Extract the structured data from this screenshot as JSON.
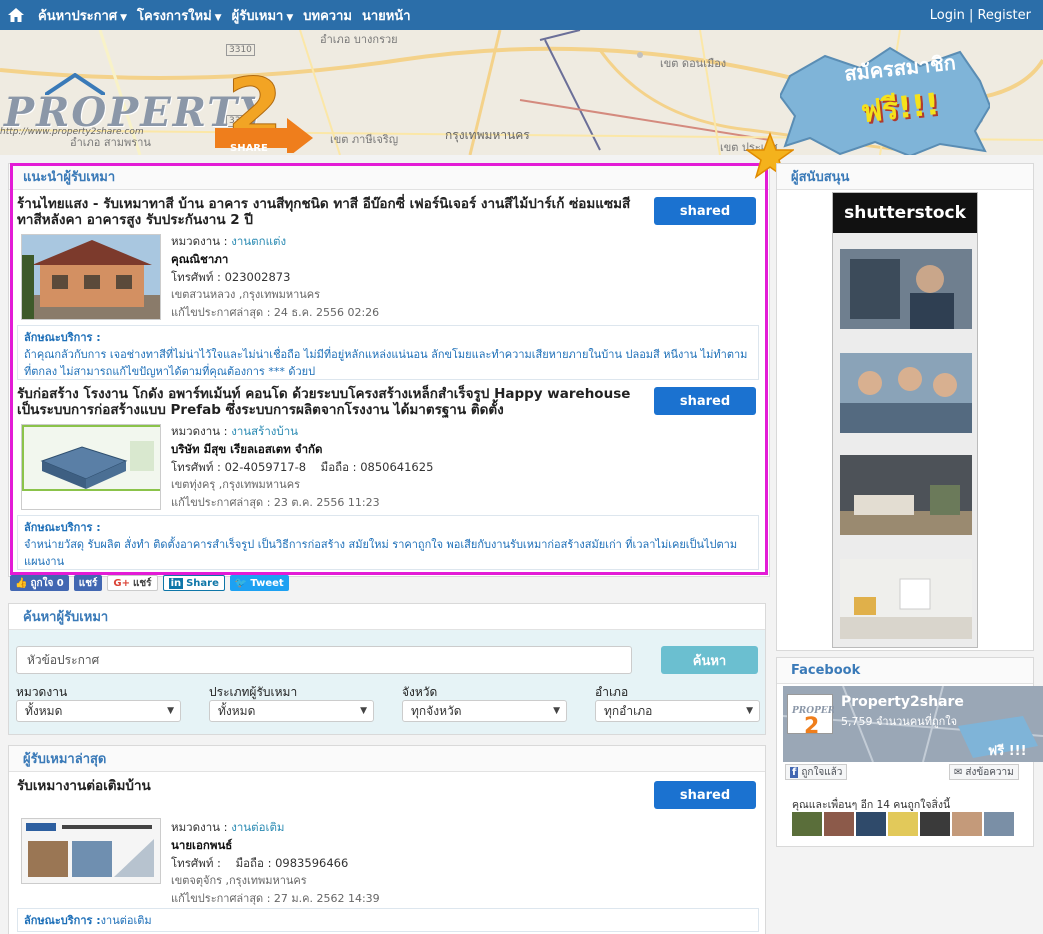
{
  "nav": {
    "items": [
      {
        "label": "ค้นหาประกาศ",
        "dropdown": true
      },
      {
        "label": "โครงการใหม่",
        "dropdown": true
      },
      {
        "label": "ผู้รับเหมา",
        "dropdown": true
      },
      {
        "label": "บทความ",
        "dropdown": false
      },
      {
        "label": "นายหน้า",
        "dropdown": false
      }
    ],
    "auth": "Login | Register"
  },
  "banner": {
    "logo_text": "PROPERTY",
    "logo_url": "http://www.property2share.com",
    "logo_badge": "SHARE",
    "signup_line1": "สมัครสมาชิก",
    "signup_line2": "ฟรี!!!",
    "map_labels": [
      "อำเภอ บางกรวย",
      "อำเภอ สามพราน",
      "กรุงเทพมหานคร",
      "เขต ภาษีเจริญ",
      "เขต ดอนเมือง",
      "เขต ประเวศ",
      "3310",
      "3310"
    ]
  },
  "recommend": {
    "title": "แนะนำผู้รับเหมา",
    "listings": [
      {
        "title": "ร้านไทยแสง - รับเหมาทาสี บ้าน อาคาร งานสีทุกชนิด ทาสี อีบ๊อกซี่ เฟอร์นิเจอร์ งานสีไม้ปาร์เก้ ซ่อมแซมสี ทาสีหลังคา อาคารสูง รับประกันงาน 2 ปี",
        "shared": "shared",
        "category_label": "หมวดงาน : ",
        "category": "งานตกแต่ง",
        "name": "คุณณิชาภา",
        "phone": "โทรศัพท์ : 023002873",
        "mobile": "",
        "location": "เขตสวนหลวง ,กรุงเทพมหานคร",
        "updated": "แก้ไขประกาศล่าสุด : 24 ธ.ค. 2556 02:26",
        "service_label": "ลักษณะบริการ :",
        "service": "ถ้าคุณกลัวกับการ เจอช่างทาสีที่ไม่น่าไว้ใจและไม่น่าเชื่อถือ ไม่มีที่อยู่หลักแหล่งแน่นอน ลักขโมยและทำความเสียหายภายในบ้าน ปลอมสี หนีงาน ไม่ทำตามที่ตกลง ไม่สามารถแก้ไขปัญหาได้ตามที่คุณต้องการ *** ด้วยป"
      },
      {
        "title": "รับก่อสร้าง โรงงาน โกดัง อพาร์ทเม้นท์ คอนโด ด้วยระบบโครงสร้างเหล็กสำเร็จรูป Happy warehouse เป็นระบบการก่อสร้างแบบ Prefab ซึ่งระบบการผลิตจากโรงงาน ได้มาตรฐาน ติดตั้ง",
        "shared": "shared",
        "category_label": "หมวดงาน : ",
        "category": "งานสร้างบ้าน",
        "name": "บริษัท มีสุข เรียลเอสเตท จำกัด",
        "phone": "โทรศัพท์ : 02-4059717-8",
        "mobile": "มือถือ : 0850641625",
        "location": "เขตทุ่งครุ ,กรุงเทพมหานคร",
        "updated": "แก้ไขประกาศล่าสุด : 23 ต.ค. 2556 11:23",
        "service_label": "ลักษณะบริการ :",
        "service": "จำหน่ายวัสดุ รับผลิต สั่งทำ ติดตั้งอาคารสำเร็จรูป เป็นวิธีการก่อสร้าง สมัยใหม่ ราคาถูกใจ พอเสียกับงานรับเหมาก่อสร้างสมัยเก่า ที่เวลาไม่เคยเป็นไปตามแผนงาน"
      }
    ]
  },
  "social": {
    "like": "ถูกใจ 0",
    "fb_share": "แชร์",
    "gplus": "แชร์",
    "linkedin": "Share",
    "tweet": "Tweet"
  },
  "search": {
    "title": "ค้นหาผู้รับเหมา",
    "input_value": "หัวข้อประกาศ",
    "button": "ค้นหา",
    "filters": [
      {
        "label": "หมวดงาน",
        "value": "ทั้งหมด"
      },
      {
        "label": "ประเภทผู้รับเหมา",
        "value": "ทั้งหมด"
      },
      {
        "label": "จังหวัด",
        "value": "ทุกจังหวัด"
      },
      {
        "label": "อำเภอ",
        "value": "ทุกอำเภอ"
      }
    ]
  },
  "latest": {
    "title": "ผู้รับเหมาล่าสุด",
    "listing": {
      "title": "รับเหมางานต่อเติมบ้าน",
      "shared": "shared",
      "category_label": "หมวดงาน : ",
      "category": "งานต่อเติม",
      "name": "นายเอกพนธ์",
      "phone": "โทรศัพท์ :",
      "mobile": "มือถือ : 0983596466",
      "location": "เขตจตุจักร ,กรุงเทพมหานคร",
      "updated": "แก้ไขประกาศล่าสุด : 27 ม.ค. 2562 14:39",
      "service_label": "ลักษณะบริการ :",
      "service": "งานต่อเติม"
    }
  },
  "sponsor": {
    "title": "ผู้สนับสนุน",
    "ad_brand": "shutterstock"
  },
  "facebook": {
    "title": "Facebook",
    "page_name": "Property2share",
    "count": "5,759 จำนวนคนที่ถูกใจ",
    "liked": "ถูกใจแล้ว",
    "message": "ส่งข้อความ",
    "friends": "คุณและเพื่อนๆ อีก 14 คนถูกใจสิ่งนี้",
    "cover_text": "ฟรี !!!"
  },
  "colors": {
    "nav": "#2b6ea9",
    "highlight": "#e31bd6",
    "shared_button": "#1b72d0",
    "link": "#1d6fb8"
  }
}
